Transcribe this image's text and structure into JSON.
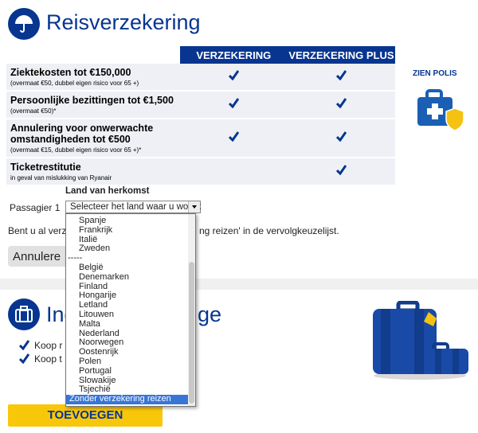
{
  "header": {
    "title": "Reisverzekering"
  },
  "table": {
    "col1": "VERZEKERING",
    "col2": "VERZEKERING PLUS",
    "rows": [
      {
        "title": "Ziektekosten tot €150,000",
        "sub": "(overmaat €50, dubbel eigen risico voor 65 +)",
        "basic": true,
        "plus": true
      },
      {
        "title": "Persoonlijke bezittingen tot €1,500",
        "sub": "(overmaat €50)*",
        "basic": true,
        "plus": true
      },
      {
        "title": "Annulering voor onwerwachte omstandigheden tot €500",
        "sub": "(overmaat €15, dubbel eigen risico voor 65 +)*",
        "basic": true,
        "plus": true
      },
      {
        "title": "Ticketrestitutie",
        "sub": "in geval van mislukking van Ryanair",
        "basic": false,
        "plus": true
      }
    ]
  },
  "zien_polis": "ZIEN POLIS",
  "form": {
    "country_label": "Land van herkomst",
    "passenger_label": "Passagier 1",
    "dropdown_value": "Selecteer het land waar u woont"
  },
  "background": {
    "insured_left": "Bent u al verze",
    "insured_right": "ng reizen' in de vervolgkeuzelijst.",
    "annul_button": "Annulere",
    "section2_left": "Ing",
    "section2_right": "ge",
    "check1": "Koop r",
    "check2": "Koop t",
    "add_button": "TOEVOEGEN"
  },
  "dropdown_options": {
    "top": [
      "Spanje",
      "Frankrijk",
      "Italië",
      "Zweden"
    ],
    "separator": "-----",
    "rest": [
      "België",
      "Denemarken",
      "Finland",
      "Hongarije",
      "Letland",
      "Litouwen",
      "Malta",
      "Nederland",
      "Noorwegen",
      "Oostenrijk",
      "Polen",
      "Portugal",
      "Slowakije",
      "Tsjechië"
    ],
    "selected": "Zonder verzekering reizen"
  },
  "colors": {
    "brand": "#073590",
    "accent": "#f9c70a",
    "shield": "#f5c211"
  }
}
